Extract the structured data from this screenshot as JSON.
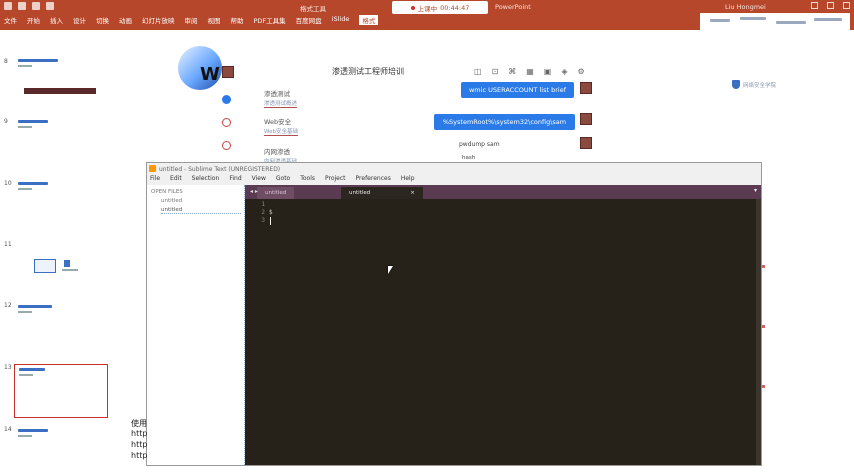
{
  "ribbon": {
    "tabs": [
      "文件",
      "开始",
      "插入",
      "设计",
      "切换",
      "动画",
      "幻灯片放映",
      "审阅",
      "视图",
      "帮助",
      "PDF工具集",
      "百度网盘",
      "iSlide",
      "格式"
    ],
    "active_tab": "格式",
    "doc_title": "格式工具",
    "timer_label": "上课中",
    "timer_value": "00:44:47",
    "ppt_name": "PowerPoint",
    "user": "Liu Hongmei"
  },
  "thumbs": [
    {
      "num": "8"
    },
    {
      "num": "9"
    },
    {
      "num": "10"
    },
    {
      "num": "11"
    },
    {
      "num": "12"
    },
    {
      "num": "13"
    },
    {
      "num": "14"
    }
  ],
  "slide": {
    "logo_letter": "W",
    "header_text": "渗透测试工程师培训",
    "nav": [
      {
        "label": "渗透测试",
        "sub": "渗透测试概述"
      },
      {
        "label": "Web安全",
        "sub": "Web安全基础"
      },
      {
        "label": "内网渗透",
        "sub": "内网渗透基础"
      }
    ],
    "shield_text": "网络安全学院",
    "pills": [
      {
        "text": "wmic USERACCOUNT list brief"
      },
      {
        "text": "%SystemRoot%\\system32\\config\\sam"
      }
    ],
    "line1": "pwdump sam",
    "line2": "hash"
  },
  "sublime": {
    "title": "untitled - Sublime Text (UNREGISTERED)",
    "menu": [
      "File",
      "Edit",
      "Selection",
      "Find",
      "View",
      "Goto",
      "Tools",
      "Project",
      "Preferences",
      "Help"
    ],
    "sidebar_header": "OPEN FILES",
    "sidebar_files": [
      "untitled",
      "untitled"
    ],
    "tabs": [
      {
        "label": "untitled"
      },
      {
        "label": "untitled"
      }
    ],
    "line_numbers": [
      "1",
      "2",
      "3"
    ],
    "code_lines": [
      "",
      "$",
      ""
    ]
  },
  "bottom_lines": [
    "使用",
    "http",
    "http",
    "http"
  ]
}
